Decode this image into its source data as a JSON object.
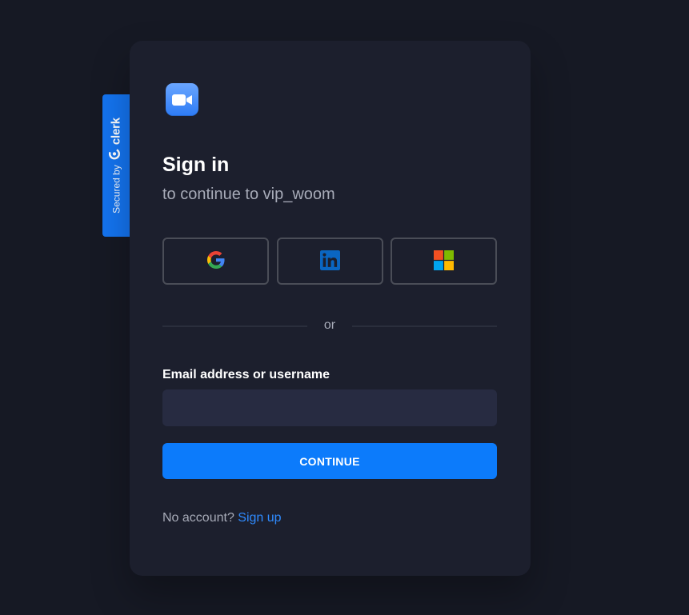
{
  "secured_badge": {
    "prefix": "Secured by",
    "brand": "clerk",
    "brand_icon": "clerk-logo-icon"
  },
  "app": {
    "logo_icon": "video-camera-icon",
    "logo_color": "#2d7bf5"
  },
  "header": {
    "title": "Sign in",
    "subtitle": "to continue to vip_woom"
  },
  "social_buttons": [
    {
      "provider": "Google",
      "icon": "google-icon"
    },
    {
      "provider": "LinkedIn",
      "icon": "linkedin-icon"
    },
    {
      "provider": "Microsoft",
      "icon": "microsoft-icon"
    }
  ],
  "divider": {
    "text": "or"
  },
  "form": {
    "email_label": "Email address or username",
    "email_value": "",
    "email_placeholder": "",
    "continue_label": "CONTINUE"
  },
  "footer": {
    "prompt": "No account?",
    "link": "Sign up"
  },
  "colors": {
    "background": "#161924",
    "card": "#1c1f2d",
    "accent": "#0c7bfb",
    "link": "#2f8bff",
    "badge": "#1474f0"
  }
}
